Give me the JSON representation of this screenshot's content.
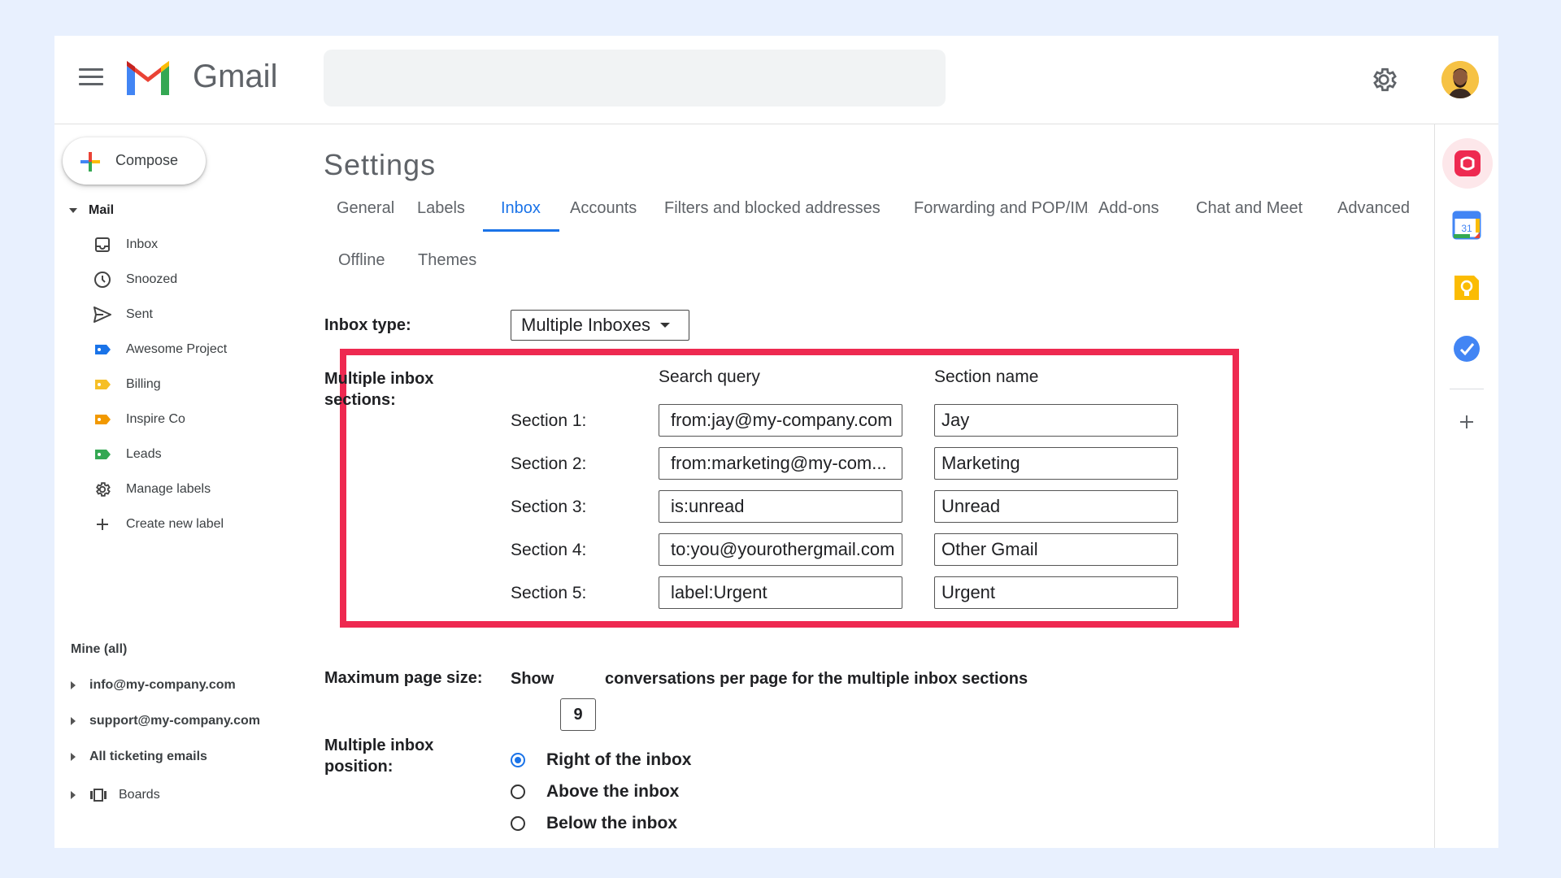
{
  "app": {
    "name": "Gmail"
  },
  "header": {
    "search_placeholder": "",
    "settings_icon": "gear-icon",
    "avatar_icon": "user-avatar"
  },
  "sidebar": {
    "compose_label": "Compose",
    "mail_section": "Mail",
    "items": [
      {
        "label": "Inbox",
        "icon": "inbox-icon"
      },
      {
        "label": "Snoozed",
        "icon": "clock-icon"
      },
      {
        "label": "Sent",
        "icon": "send-icon"
      },
      {
        "label": "Awesome Project",
        "icon": "label-icon",
        "color": "#1a73e8"
      },
      {
        "label": "Billing",
        "icon": "label-icon",
        "color": "#f6bf26"
      },
      {
        "label": "Inspire Co",
        "icon": "label-icon",
        "color": "#f29900"
      },
      {
        "label": "Leads",
        "icon": "label-icon",
        "color": "#34a853"
      },
      {
        "label": "Manage labels",
        "icon": "gear-icon"
      },
      {
        "label": "Create new label",
        "icon": "plus-icon"
      }
    ],
    "mine_label": "Mine (all)",
    "accounts": [
      {
        "label": "info@my-company.com"
      },
      {
        "label": "support@my-company.com"
      },
      {
        "label": "All ticketing emails"
      }
    ],
    "boards_label": "Boards"
  },
  "settings": {
    "title": "Settings",
    "tabs": [
      {
        "label": "General"
      },
      {
        "label": "Labels"
      },
      {
        "label": "Inbox",
        "active": true
      },
      {
        "label": "Accounts"
      },
      {
        "label": "Filters and blocked addresses"
      },
      {
        "label": "Forwarding and POP/IMAP"
      },
      {
        "label": "Add-ons"
      },
      {
        "label": "Chat and Meet"
      },
      {
        "label": "Advanced"
      },
      {
        "label": "Offline"
      },
      {
        "label": "Themes"
      }
    ],
    "inbox_type": {
      "label": "Inbox type:",
      "value": "Multiple Inboxes"
    },
    "multiple_sections": {
      "label_line1": "Multiple inbox",
      "label_line2": "sections:",
      "col_query": "Search query",
      "col_name": "Section name",
      "rows": [
        {
          "label": "Section 1:",
          "query": "from:jay@my-company.com",
          "name": "Jay"
        },
        {
          "label": "Section 2:",
          "query": "from:marketing@my-com...",
          "name": "Marketing"
        },
        {
          "label": "Section 3:",
          "query": "is:unread",
          "name": "Unread"
        },
        {
          "label": "Section 4:",
          "query": "to:you@yourothergmail.com",
          "name": "Other Gmail"
        },
        {
          "label": "Section 5:",
          "query": "label:Urgent",
          "name": "Urgent"
        }
      ]
    },
    "page_size": {
      "label": "Maximum page size:",
      "show": "Show",
      "value": "9",
      "suffix": "conversations per page for the multiple inbox sections"
    },
    "position": {
      "label_line1": "Multiple inbox",
      "label_line2": "position:",
      "options": [
        {
          "label": "Right of the inbox",
          "checked": true
        },
        {
          "label": "Above the inbox",
          "checked": false
        },
        {
          "label": "Below the inbox",
          "checked": false
        }
      ]
    }
  },
  "colors": {
    "accent": "#1a73e8",
    "highlight_border": "#ee2950"
  }
}
